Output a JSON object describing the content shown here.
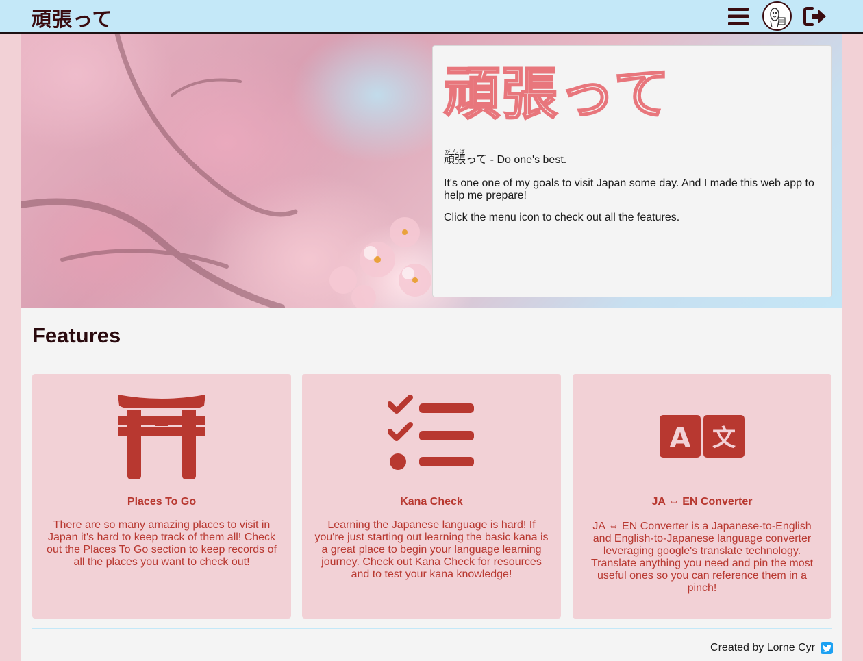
{
  "navbar": {
    "brand": "頑張って",
    "menu_icon": "hamburger-menu-icon",
    "avatar_icon": "user-avatar",
    "logout_icon": "sign-out-icon"
  },
  "hero": {
    "title": "頑張って",
    "word": "頑張",
    "reading": "がんば",
    "word_suffix": "って",
    "meaning": " - Do one's best.",
    "paragraph_1": "It's one one of my goals to visit Japan some day. And I made this web app to help me prepare!",
    "paragraph_2": "Click the menu icon to check out all the features."
  },
  "features": {
    "heading": "Features",
    "cards": [
      {
        "icon": "torii-gate-icon",
        "title": "Places To Go",
        "text": "There are so many amazing places to visit in Japan it's hard to keep track of them all! Check out the Places To Go section to keep records of all the places you want to check out!"
      },
      {
        "icon": "task-list-icon",
        "title": "Kana Check",
        "text": "Learning the Japanese language is hard! If you're just starting out learning the basic kana is a great place to begin your language learning journey. Check out Kana Check for resources and to test your kana knowledge!"
      },
      {
        "icon": "language-translate-icon",
        "title": "JA ⇔ EN Converter",
        "text": "JA ⇔ EN Converter is a Japanese-to-English and English-to-Japanese language converter leveraging google's translate technology. Translate anything you need and pin the most useful ones so you can reference them in a pinch!"
      }
    ]
  },
  "footer": {
    "credit": "Created by Lorne Cyr",
    "social_icon": "twitter-icon"
  },
  "colors": {
    "nav_bg": "#c4e8f8",
    "accent": "#b83830",
    "card_bg": "#f2d1d6",
    "title_outline": "#e8767c",
    "dark_text": "#3a0c10"
  }
}
